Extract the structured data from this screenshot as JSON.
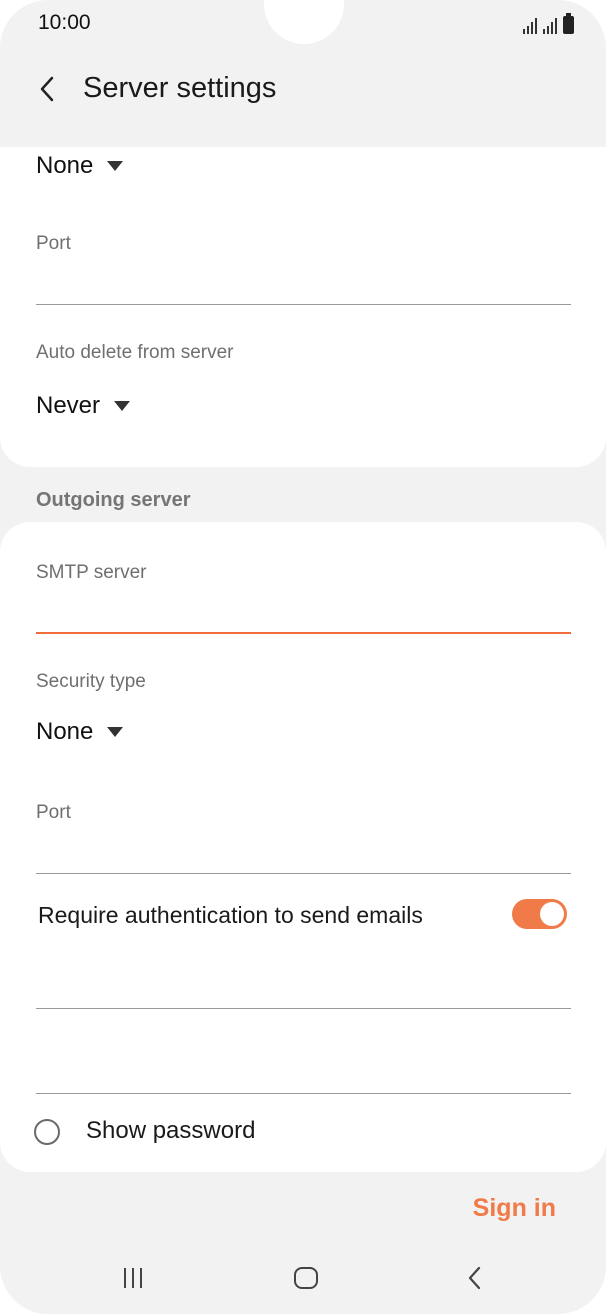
{
  "status": {
    "time": "10:00"
  },
  "header": {
    "title": "Server settings"
  },
  "incoming": {
    "security_value": "None",
    "port_label": "Port",
    "port_value": "",
    "auto_delete_label": "Auto delete from server",
    "auto_delete_value": "Never"
  },
  "outgoing": {
    "section_title": "Outgoing server",
    "smtp_label": "SMTP server",
    "smtp_value": "",
    "security_label": "Security type",
    "security_value": "None",
    "port_label": "Port",
    "port_value": "",
    "require_auth_label": "Require authentication to send emails",
    "require_auth_on": true,
    "show_password_label": "Show password"
  },
  "actions": {
    "sign_in_label": "Sign in"
  },
  "colors": {
    "accent": "#f07a48",
    "background": "#f2f2f2",
    "card": "#ffffff"
  },
  "icons": {
    "back": "chevron-left-icon",
    "dropdown": "caret-down-icon",
    "nav_recents": "recents-icon",
    "nav_home": "home-icon",
    "nav_back": "back-icon"
  }
}
